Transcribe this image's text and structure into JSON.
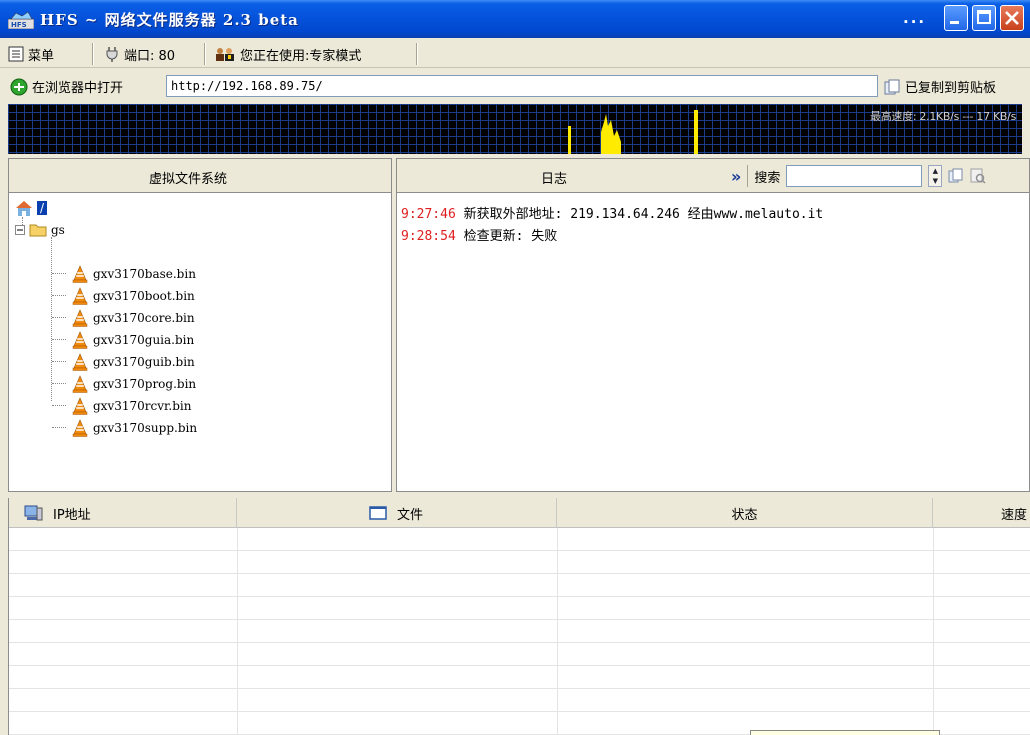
{
  "window": {
    "title": "HFS ~ 网络文件服务器 2.3 beta",
    "extra": "..."
  },
  "toolbar": {
    "menu_label": "菜单",
    "port_label": "端口: 80",
    "mode_label": "您正在使用:专家模式"
  },
  "address": {
    "open_label": "在浏览器中打开",
    "url": "http://192.168.89.75/",
    "copied_label": "已复制到剪贴板"
  },
  "graph": {
    "speed_label": "最高速度: 2.1KB/s --- 17 KB/s"
  },
  "vfs": {
    "header": "虚拟文件系统",
    "root": "/",
    "folder": "gs",
    "files": [
      "gxv3170base.bin",
      "gxv3170boot.bin",
      "gxv3170core.bin",
      "gxv3170guia.bin",
      "gxv3170guib.bin",
      "gxv3170prog.bin",
      "gxv3170rcvr.bin",
      "gxv3170supp.bin"
    ]
  },
  "log": {
    "header": "日志",
    "search_label": "搜索",
    "entries": [
      {
        "time": "9:27:46",
        "text": "新获取外部地址: 219.134.64.246 经由www.melauto.it"
      },
      {
        "time": "9:28:54",
        "text": "检查更新: 失败"
      }
    ]
  },
  "connections": {
    "columns": [
      "IP地址",
      "文件",
      "状态",
      "速度"
    ]
  },
  "colors": {
    "title_blue": "#0450d8",
    "log_time_red": "#e02020",
    "graph_yellow": "#ffeb00"
  }
}
